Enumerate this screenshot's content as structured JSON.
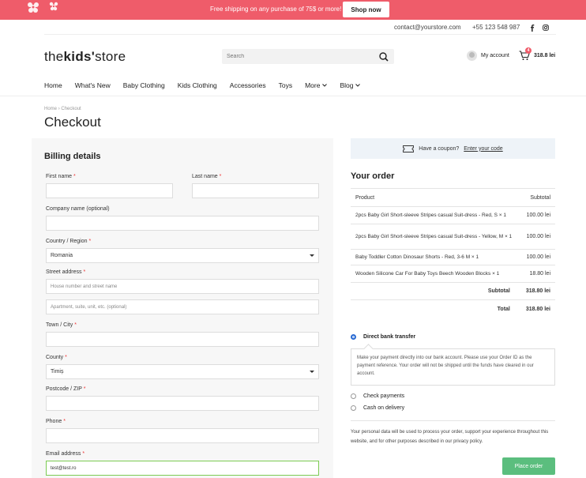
{
  "topbar": {
    "promo": "Free shipping on any purchase of 75$ or more!",
    "shop_button": "Shop now"
  },
  "contact": {
    "email": "contact@yourstore.com",
    "phone": "+55 123 548 987"
  },
  "header": {
    "logo": {
      "pre": "the",
      "bold": "kids'",
      "post": "store"
    },
    "search_placeholder": "Search",
    "account_label": "My account",
    "cart_count": "4",
    "cart_total": "318.8 lei"
  },
  "nav": [
    "Home",
    "What's New",
    "Baby Clothing",
    "Kids Clothing",
    "Accessories",
    "Toys",
    "More",
    "Blog"
  ],
  "breadcrumb": {
    "home": "Home",
    "sep": "›",
    "current": "Checkout"
  },
  "page_title": "Checkout",
  "billing": {
    "title": "Billing details",
    "first_name": "First name",
    "last_name": "Last name",
    "company": "Company name (optional)",
    "country_label": "Country / Region",
    "country_value": "Romania",
    "street_label": "Street address",
    "street_placeholder": "House number and street name",
    "street2_placeholder": "Apartment, suite, unit, etc. (optional)",
    "town_label": "Town / City",
    "county_label": "County",
    "county_value": "Timiș",
    "postcode_label": "Postcode / ZIP",
    "phone_label": "Phone",
    "email_label": "Email address",
    "email_value": "test@test.ro",
    "required_mark": "*"
  },
  "coupon": {
    "text": "Have a coupon?",
    "link": "Enter your code"
  },
  "order": {
    "title": "Your order",
    "col_product": "Product",
    "col_subtotal": "Subtotal",
    "items": [
      {
        "name": "2pcs Baby Girl Short-sleeve Stripes casual Suit-dress - Red, S  × 1",
        "price": "100.00 lei"
      },
      {
        "name": "2pcs Baby Girl Short-sleeve Stripes casual Suit-dress - Yellow, M  × 1",
        "price": "100.00 lei"
      },
      {
        "name": "Baby Toddler Cotton Dinosaur Shorts - Red, 3-6 M  × 1",
        "price": "100.00 lei"
      },
      {
        "name": "Wooden Silicone Car For Baby Toys Beech Wooden Blocks  × 1",
        "price": "18.80 lei"
      }
    ],
    "subtotal_label": "Subtotal",
    "subtotal_value": "318.80 lei",
    "total_label": "Total",
    "total_value": "318.80 lei"
  },
  "payment": {
    "bank": "Direct bank transfer",
    "bank_desc": "Make your payment directly into our bank account. Please use your Order ID as the payment reference. Your order will not be shipped until the funds have cleared in our account.",
    "check": "Check payments",
    "cod": "Cash on delivery"
  },
  "privacy_text": "Your personal data will be used to process your order, support your experience throughout this website, and for other purposes described in our privacy policy.",
  "place_order": "Place order",
  "colors": {
    "banner": "#ef5c6a",
    "place_order": "#5bbe7e",
    "focus_border": "#7ccb53"
  },
  "icons": [
    "flower-icon",
    "facebook-icon",
    "instagram-icon",
    "search-icon",
    "user-icon",
    "cart-icon",
    "chevron-down-icon",
    "ticket-icon"
  ]
}
